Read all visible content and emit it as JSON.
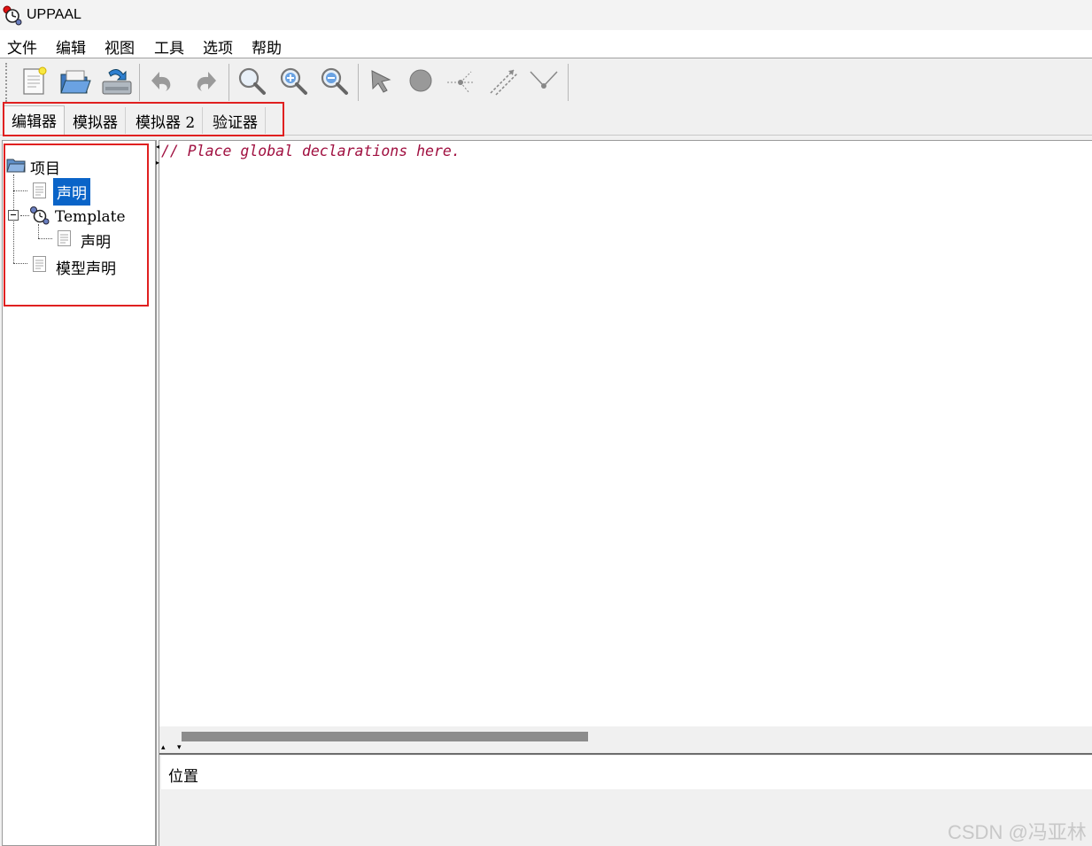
{
  "window": {
    "title": "UPPAAL"
  },
  "menu": {
    "items": [
      {
        "label": "文件"
      },
      {
        "label": "编辑"
      },
      {
        "label": "视图"
      },
      {
        "label": "工具"
      },
      {
        "label": "选项"
      },
      {
        "label": "帮助"
      }
    ]
  },
  "toolbar": {
    "buttons": [
      {
        "icon": "new-document-icon"
      },
      {
        "icon": "open-folder-icon"
      },
      {
        "icon": "save-icon"
      },
      {
        "icon": "undo-icon"
      },
      {
        "icon": "redo-icon"
      },
      {
        "icon": "zoom-icon"
      },
      {
        "icon": "zoom-in-icon"
      },
      {
        "icon": "zoom-out-icon"
      },
      {
        "icon": "select-pointer-icon"
      },
      {
        "icon": "add-location-icon"
      },
      {
        "icon": "add-branchpoint-icon"
      },
      {
        "icon": "add-edge-icon"
      },
      {
        "icon": "add-nail-icon"
      }
    ]
  },
  "tabs": [
    {
      "label": "编辑器",
      "active": true
    },
    {
      "label": "模拟器",
      "active": false
    },
    {
      "label": "模拟器 2",
      "active": false
    },
    {
      "label": "验证器",
      "active": false
    }
  ],
  "tree": {
    "root": "项目",
    "items": [
      {
        "label": "声明",
        "selected": true
      },
      {
        "label": "Template",
        "expanded": true
      },
      {
        "label": "声明"
      },
      {
        "label": "模型声明"
      }
    ]
  },
  "editor": {
    "content": "// Place global declarations here."
  },
  "location_panel": {
    "label": "位置"
  },
  "watermark": "CSDN @冯亚林",
  "colors": {
    "selection": "#0a64c8",
    "code_comment": "#a01040",
    "highlight_box": "#e02020"
  }
}
